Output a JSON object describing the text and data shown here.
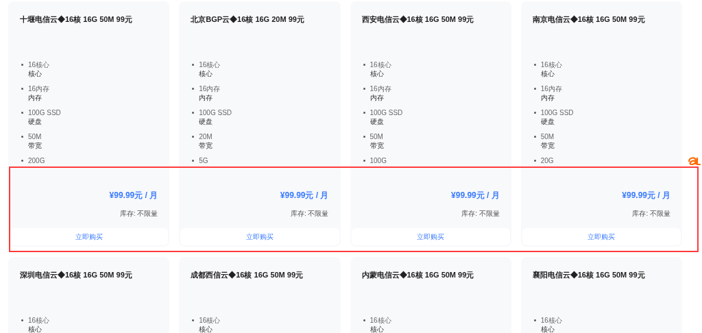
{
  "cards": [
    {
      "title": "十堰电信云◆16核 16G 50M 99元",
      "specs": [
        {
          "value": "16核心",
          "label": "核心"
        },
        {
          "value": "16内存",
          "label": "内存"
        },
        {
          "value": "100G SSD",
          "label": "硬盘"
        },
        {
          "value": "50M",
          "label": "带宽"
        },
        {
          "value": "200G"
        }
      ],
      "price": "¥99.99元 / 月",
      "stock": "库存: 不限量",
      "button": "立即购买"
    },
    {
      "title": "北京BGP云◆16核 16G 20M 99元",
      "specs": [
        {
          "value": "16核心",
          "label": "核心"
        },
        {
          "value": "16内存",
          "label": "内存"
        },
        {
          "value": "100G SSD",
          "label": "硬盘"
        },
        {
          "value": "20M",
          "label": "带宽"
        },
        {
          "value": "5G"
        }
      ],
      "price": "¥99.99元 / 月",
      "stock": "库存: 不限量",
      "button": "立即购买"
    },
    {
      "title": "西安电信云◆16核 16G 50M 99元",
      "specs": [
        {
          "value": "16核心",
          "label": "核心"
        },
        {
          "value": "16内存",
          "label": "内存"
        },
        {
          "value": "100G SSD",
          "label": "硬盘"
        },
        {
          "value": "50M",
          "label": "带宽"
        },
        {
          "value": "100G"
        }
      ],
      "price": "¥99.99元 / 月",
      "stock": "库存: 不限量",
      "button": "立即购买"
    },
    {
      "title": "南京电信云◆16核 16G 50M 99元",
      "specs": [
        {
          "value": "16核心",
          "label": "核心"
        },
        {
          "value": "16内存",
          "label": "内存"
        },
        {
          "value": "100G SSD",
          "label": "硬盘"
        },
        {
          "value": "50M",
          "label": "带宽"
        },
        {
          "value": "20G"
        }
      ],
      "price": "¥99.99元 / 月",
      "stock": "库存: 不限量",
      "button": "立即购买"
    },
    {
      "title": "深圳电信云◆16核 16G 50M 99元",
      "specs": [
        {
          "value": "16核心",
          "label": "核心"
        }
      ]
    },
    {
      "title": "成都西信云◆16核 16G 50M 99元",
      "specs": [
        {
          "value": "16核心",
          "label": "核心"
        }
      ]
    },
    {
      "title": "内蒙电信云◆16核 16G 50M 99元",
      "specs": [
        {
          "value": "16核心",
          "label": "核心"
        }
      ]
    },
    {
      "title": "襄阳电信云◆16核 16G 50M 99元",
      "specs": [
        {
          "value": "16核心",
          "label": "核心"
        }
      ]
    }
  ]
}
